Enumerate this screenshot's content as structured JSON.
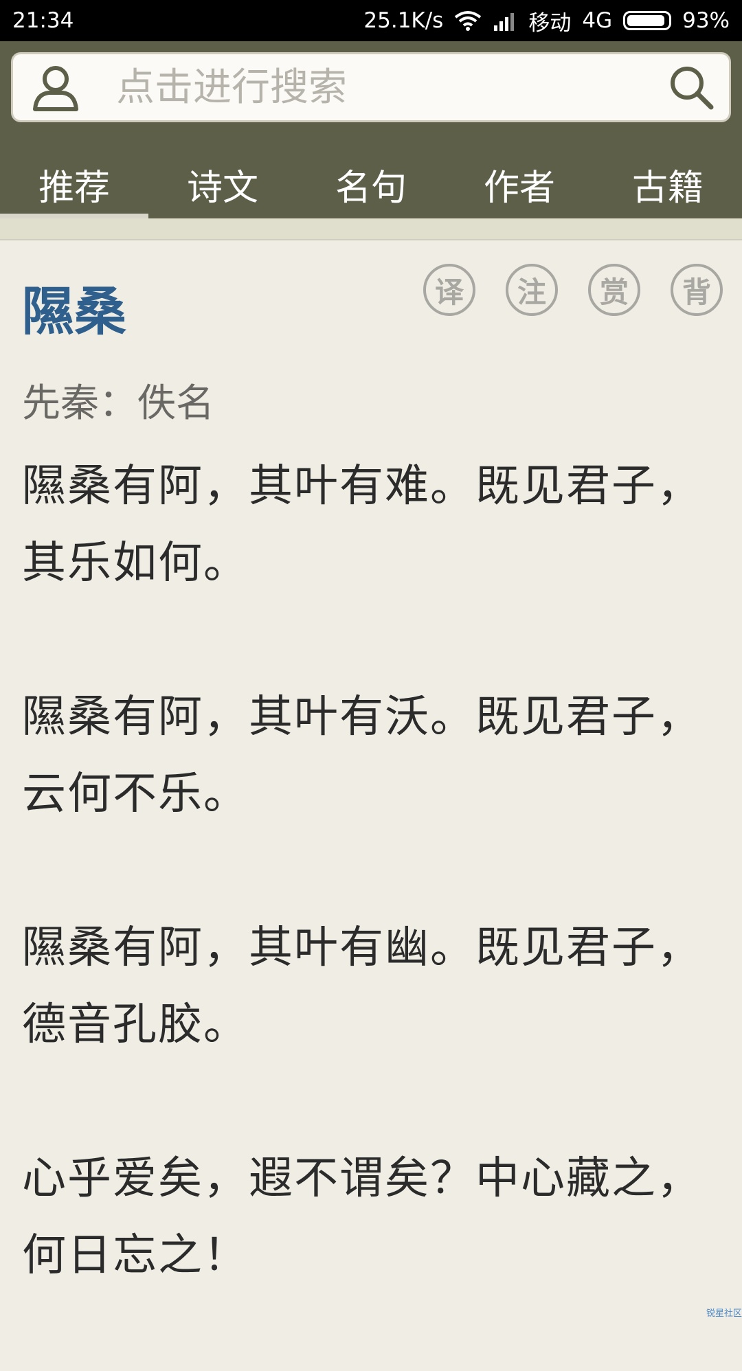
{
  "status_bar": {
    "time": "21:34",
    "speed": "25.1K/s",
    "carrier": "移动",
    "network": "4G",
    "battery": "93%",
    "battery_level": 0.93
  },
  "search": {
    "placeholder": "点击进行搜索"
  },
  "tabs": [
    {
      "label": "推荐",
      "active": true
    },
    {
      "label": "诗文",
      "active": false
    },
    {
      "label": "名句",
      "active": false
    },
    {
      "label": "作者",
      "active": false
    },
    {
      "label": "古籍",
      "active": false
    }
  ],
  "poem": {
    "title": "隰桑",
    "author_line": "先秦：佚名",
    "actions": [
      "译",
      "注",
      "赏",
      "背"
    ],
    "stanzas": [
      "隰桑有阿，其叶有难。既见君子，其乐如何。",
      "隰桑有阿，其叶有沃。既见君子，云何不乐。",
      "隰桑有阿，其叶有幽。既见君子，德音孔胶。",
      "心乎爱矣，遐不谓矣？中心藏之，何日忘之！"
    ]
  },
  "watermark": "锐星社区",
  "colors": {
    "header_bg": "#5d5f49",
    "page_bg": "#f0eee4",
    "title_blue": "#2f5f8d"
  }
}
